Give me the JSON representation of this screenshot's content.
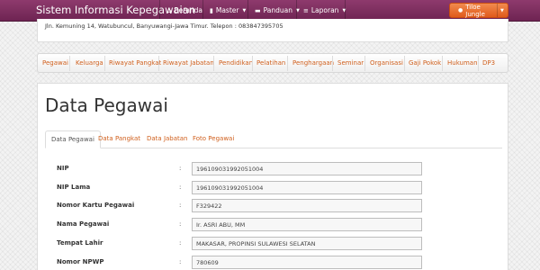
{
  "navbar": {
    "brand": "Sistem Informasi Kepegawaian",
    "items": [
      {
        "label": "Beranda",
        "icon": "home-icon",
        "icon_glyph": "⌂",
        "caret": ""
      },
      {
        "label": "Master",
        "icon": "document-icon",
        "icon_glyph": "▮",
        "caret": "▼"
      },
      {
        "label": "Panduan",
        "icon": "comment-icon",
        "icon_glyph": "▬",
        "caret": "▼"
      },
      {
        "label": "Laporan",
        "icon": "list-icon",
        "icon_glyph": "≡",
        "caret": "▼"
      }
    ],
    "user": {
      "label": "Tiloe Jungle",
      "icon": "user-icon",
      "icon_glyph": "●",
      "caret": "▼"
    }
  },
  "header": {
    "address": "Jln. Kemuning 14, Watubuncul, Banyuwangi-Jawa Timur. Telepon : 083847395705"
  },
  "menu": {
    "items": [
      "Pegawai",
      "Keluarga",
      "Riwayat Pangkat",
      "Riwayat Jabatan",
      "Pendidikan",
      "Pelatihan",
      "Penghargaan",
      "Seminar",
      "Organisasi",
      "Gaji Pokok",
      "Hukuman",
      "DP3"
    ]
  },
  "main": {
    "title": "Data Pegawai",
    "tabs": [
      "Data Pegawai",
      "Data Pangkat",
      "Data Jabatan",
      "Foto Pegawai"
    ],
    "active_tab": "Data Pegawai",
    "colon": ":",
    "fields": [
      {
        "label": "NIP",
        "value": "196109031992051004"
      },
      {
        "label": "NIP Lama",
        "value": "196109031992051004"
      },
      {
        "label": "Nomor Kartu Pegawai",
        "value": "F329422"
      },
      {
        "label": "Nama Pegawai",
        "value": "Ir. ASRI ABU, MM"
      },
      {
        "label": "Tempat Lahir",
        "value": "MAKASAR, PROPINSI SULAWESI SELATAN"
      },
      {
        "label": "Nomor NPWP",
        "value": "780609"
      }
    ]
  },
  "colors": {
    "navbar": "#7a2b5c",
    "accent": "#d0601e",
    "user_button": "#e8692a"
  }
}
